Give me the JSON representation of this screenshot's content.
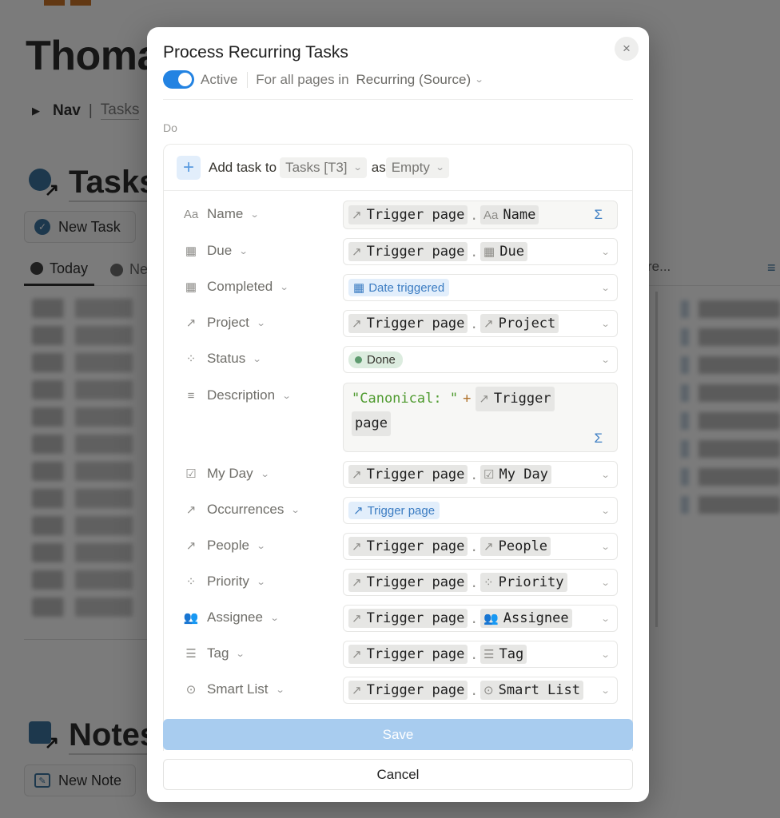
{
  "background": {
    "page_title": "Thoma",
    "nav_toggle": "Nav",
    "nav_separator": "|",
    "nav_link": "Tasks",
    "tasks_section": {
      "title": "Tasks",
      "new_button": "New Task"
    },
    "views": [
      {
        "label": "Today",
        "active": true
      },
      {
        "label": "Ne",
        "active": false
      }
    ],
    "more_views": "re...",
    "notes_section": {
      "title": "Notes",
      "new_button": "New Note"
    }
  },
  "modal": {
    "title": "Process Recurring Tasks",
    "active_toggle": {
      "label": "Active",
      "on": true
    },
    "trigger_prefix": "For all pages in",
    "trigger_source": "Recurring (Source)",
    "do_label": "Do",
    "action": {
      "verb": "Add task to",
      "database": "Tasks [T3]",
      "as_label": "as",
      "template": "Empty"
    },
    "trigger_token": "Trigger page",
    "properties": [
      {
        "name": "Name",
        "icon": "Aa",
        "icon_name": "text-icon",
        "kind": "formula",
        "target": "Name",
        "target_icon": "Aa"
      },
      {
        "name": "Due",
        "icon": "▦",
        "icon_name": "calendar-icon",
        "kind": "ref",
        "target": "Due",
        "target_icon": "▦"
      },
      {
        "name": "Completed",
        "icon": "▦",
        "icon_name": "calendar-icon",
        "kind": "chip-blue",
        "value": "Date triggered",
        "value_icon": "▦"
      },
      {
        "name": "Project",
        "icon": "↗",
        "icon_name": "relation-icon",
        "kind": "ref",
        "target": "Project",
        "target_icon": "↗"
      },
      {
        "name": "Status",
        "icon": "⁘",
        "icon_name": "status-icon",
        "kind": "chip-green",
        "value": "Done"
      },
      {
        "name": "Description",
        "icon": "≡",
        "icon_name": "text-lines-icon",
        "kind": "description",
        "string": "\"Canonical: \"",
        "operator": "+",
        "token_line1": "Trigger",
        "token_line2": "page"
      },
      {
        "name": "My Day",
        "icon": "☑",
        "icon_name": "checkbox-icon",
        "kind": "ref",
        "target": "My Day",
        "target_icon": "☑"
      },
      {
        "name": "Occurrences",
        "icon": "↗",
        "icon_name": "relation-icon",
        "kind": "chip-blue",
        "value": "Trigger page",
        "value_icon": "↗"
      },
      {
        "name": "People",
        "icon": "↗",
        "icon_name": "relation-icon",
        "kind": "ref",
        "target": "People",
        "target_icon": "↗"
      },
      {
        "name": "Priority",
        "icon": "⁘",
        "icon_name": "status-icon",
        "kind": "ref",
        "target": "Priority",
        "target_icon": "⁘"
      },
      {
        "name": "Assignee",
        "icon": "👥",
        "icon_name": "people-icon",
        "kind": "ref",
        "target": "Assignee",
        "target_icon": "👥"
      },
      {
        "name": "Tag",
        "icon": "☰",
        "icon_name": "list-icon",
        "kind": "ref",
        "target": "Tag",
        "target_icon": "☰"
      },
      {
        "name": "Smart List",
        "icon": "⊙",
        "icon_name": "select-icon",
        "kind": "ref",
        "target": "Smart List",
        "target_icon": "⊙"
      }
    ],
    "save_label": "Save",
    "cancel_label": "Cancel",
    "close_icon": "×"
  },
  "colors": {
    "accent": "#2383e2",
    "save_disabled": "#a8ccef",
    "chip_blue_bg": "#e2eefb",
    "chip_green_bg": "#dcecdf",
    "formula_string": "#4e9a2e"
  }
}
